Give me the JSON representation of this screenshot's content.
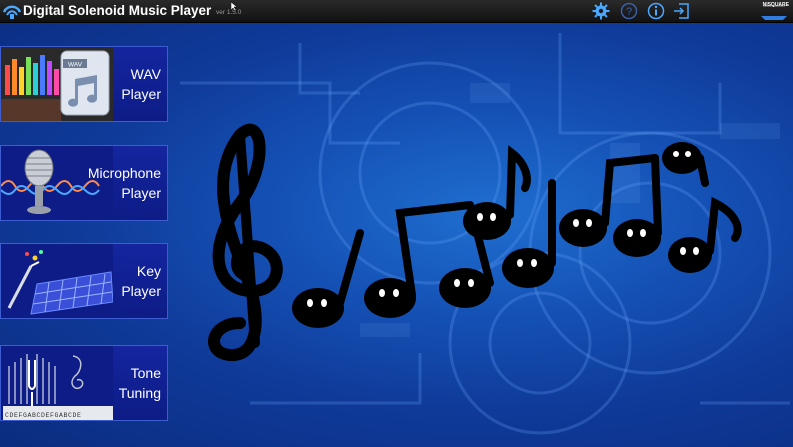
{
  "titlebar": {
    "title": "Digital Solenoid Music Player",
    "version": "ver 1.5.0",
    "icons": [
      "settings-gear-icon",
      "help-icon",
      "info-icon",
      "exit-icon"
    ],
    "brand": "NISQUARE"
  },
  "menu": [
    {
      "line1": "WAV",
      "line2": "Player",
      "icon": "wav-file-icon"
    },
    {
      "line1": "Microphone",
      "line2": "Player",
      "icon": "microphone-icon"
    },
    {
      "line1": "Key",
      "line2": "Player",
      "icon": "keyboard-icon"
    },
    {
      "line1": "Tone",
      "line2": "Tuning",
      "icon": "tuning-fork-icon"
    }
  ],
  "thumbnail_text": {
    "wav_badge": "WAV",
    "tone_keys": "CDEFGABCDEFGABCDE"
  },
  "colors": {
    "titlebar": "#1a1a1a",
    "background": "#1552b6",
    "menu_button": "#14259f",
    "accent": "#4aa8ff"
  }
}
